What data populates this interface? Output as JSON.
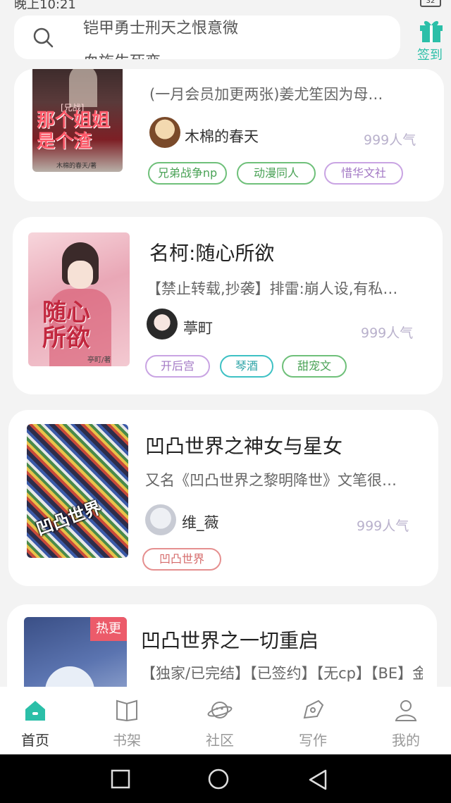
{
  "status_bar": {
    "time": "晚上10:21",
    "battery": "32"
  },
  "search": {
    "hint_line1": "铠甲勇士刑天之恨意微",
    "hint_line2": "血族生死恋"
  },
  "signin": {
    "label": "签到"
  },
  "books": [
    {
      "title": "",
      "cover_text": "那个姐姐是个渣",
      "cover_tag": "[兄战]",
      "cover_author": "木棉的春天/著",
      "description": "(一月会员加更两张)姜尤笙因为母…",
      "author": "木棉的春天",
      "popularity": "999人气",
      "tags": [
        {
          "label": "兄弟战争np",
          "color": "green"
        },
        {
          "label": "动漫同人",
          "color": "green"
        },
        {
          "label": "惜华文社",
          "color": "purple"
        }
      ]
    },
    {
      "title": "名柯:随心所欲",
      "cover_text": "随心所欲",
      "cover_author": "亭町/著",
      "description": "【禁止转载,抄袭】排雷:崩人设,有私…",
      "author": "葶町",
      "popularity": "999人气",
      "tags": [
        {
          "label": "开后宫",
          "color": "purple"
        },
        {
          "label": "琴酒",
          "color": "cyan"
        },
        {
          "label": "甜宠文",
          "color": "green"
        }
      ]
    },
    {
      "title": "凹凸世界之神女与星女",
      "cover_text": "凹凸世界",
      "description": "又名《凹凸世界之黎明降世》文笔很…",
      "author": "维_薇",
      "popularity": "999人气",
      "tags": [
        {
          "label": "凹凸世界",
          "color": "red"
        }
      ]
    },
    {
      "title": "凹凸世界之一切重启",
      "cover_badge": "热更",
      "description": "【独家/已完结】【已签约】【无cp】【BE】金:…",
      "author": "",
      "popularity": "",
      "tags": []
    }
  ],
  "bottom_nav": [
    {
      "label": "首页",
      "icon": "home-icon",
      "active": true
    },
    {
      "label": "书架",
      "icon": "book-icon",
      "active": false
    },
    {
      "label": "社区",
      "icon": "planet-icon",
      "active": false
    },
    {
      "label": "写作",
      "icon": "pen-icon",
      "active": false
    },
    {
      "label": "我的",
      "icon": "person-icon",
      "active": false
    }
  ],
  "colors": {
    "accent": "#2bbfa8",
    "tag_green": "#4aa256",
    "tag_purple": "#a277c4",
    "tag_cyan": "#2ea4a7",
    "tag_red": "#d56a6a"
  }
}
